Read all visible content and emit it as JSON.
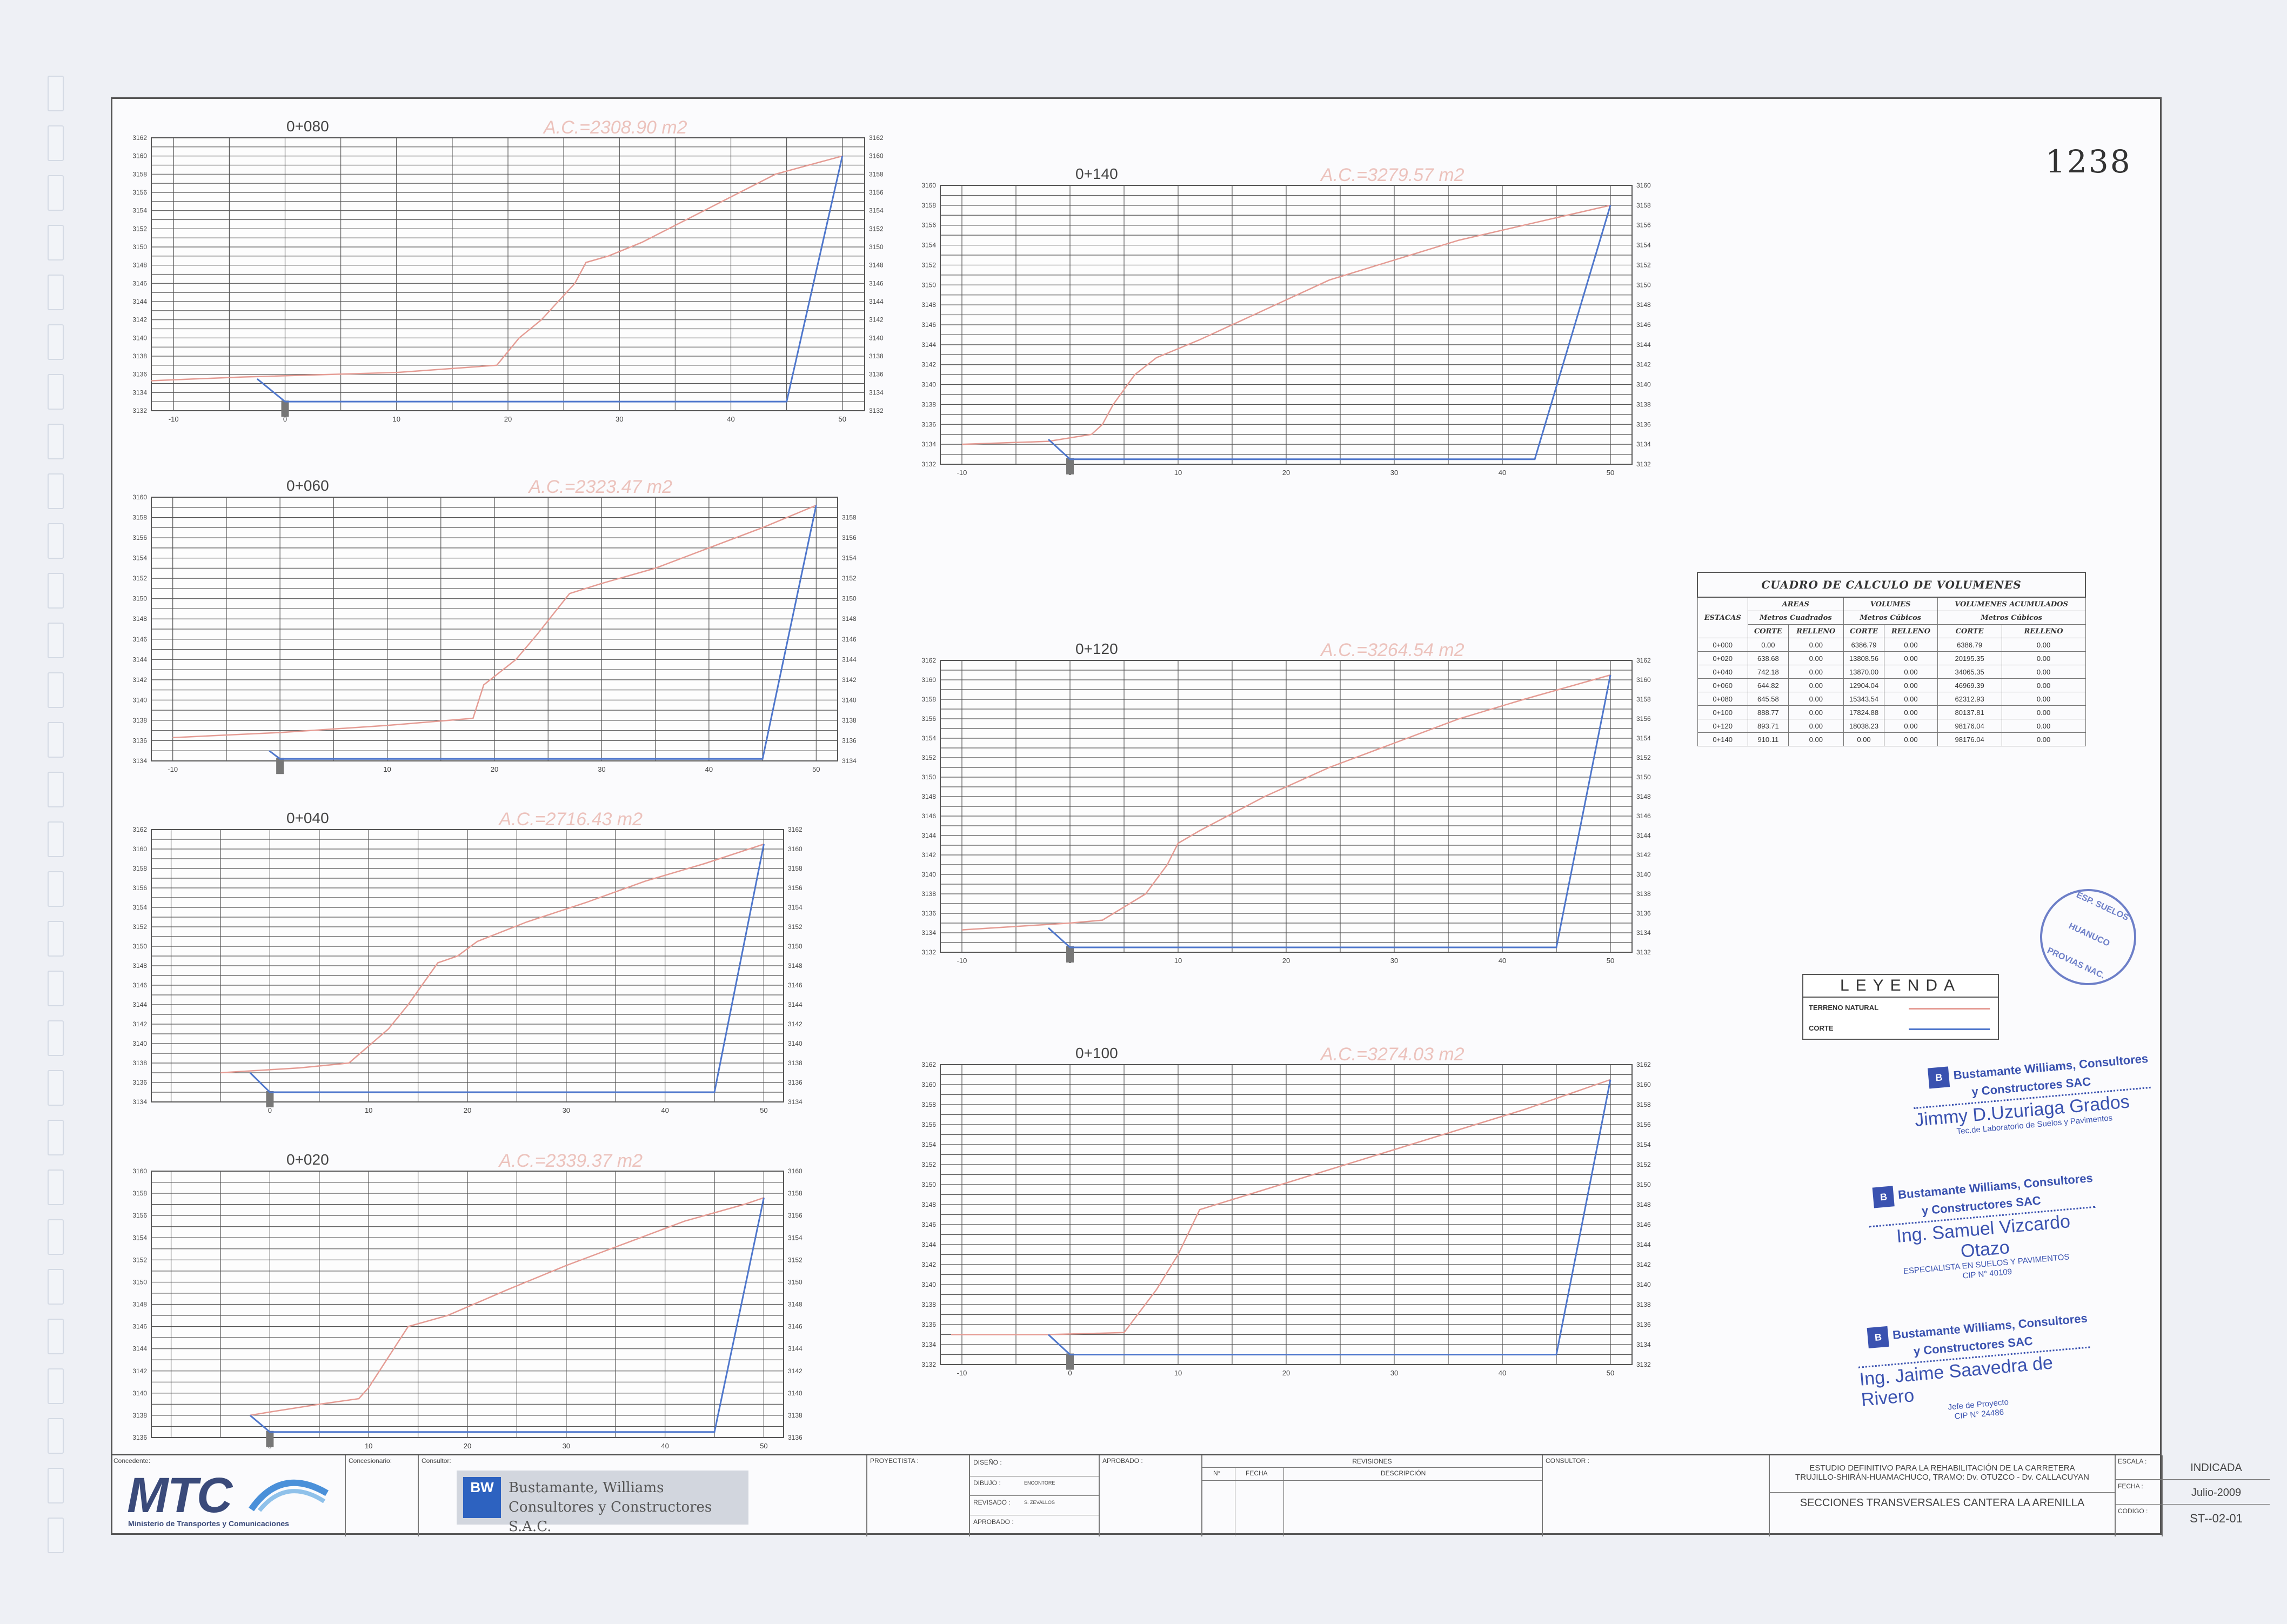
{
  "sheet": {
    "page_number": "1238",
    "sections": [
      {
        "station": "0+080",
        "area": "A.C.=2308.90  m2",
        "x_ticks": [
          "-10",
          "0",
          "10",
          "20",
          "30",
          "40",
          "50"
        ],
        "y_ticks": [
          "3132",
          "3134",
          "3136",
          "3138",
          "3140",
          "3142",
          "3144",
          "3146",
          "3148",
          "3150",
          "3152",
          "3154",
          "3156",
          "3158",
          "3160",
          "3162"
        ],
        "right_ticks": [
          "3132",
          "3134",
          "3136",
          "3138",
          "3140",
          "3142",
          "3144",
          "3146",
          "3148",
          "3150",
          "3152",
          "3154",
          "3156",
          "3158",
          "3160",
          "3162"
        ],
        "ymin": 3132,
        "ymax": 3162,
        "terrain": [
          [
            -12,
            3135.3
          ],
          [
            -4,
            3135.7
          ],
          [
            10,
            3136.2
          ],
          [
            19,
            3137
          ],
          [
            21,
            3140
          ],
          [
            23,
            3142
          ],
          [
            26,
            3146
          ],
          [
            27,
            3148.3
          ],
          [
            29,
            3149
          ],
          [
            32,
            3150.5
          ],
          [
            36,
            3153
          ],
          [
            40,
            3155.5
          ],
          [
            44,
            3158
          ],
          [
            50,
            3160
          ]
        ],
        "cut": [
          [
            -2.5,
            3135.5
          ],
          [
            0,
            3133
          ],
          [
            45,
            3133
          ],
          [
            50,
            3160
          ]
        ]
      },
      {
        "station": "0+060",
        "area": "A.C.=2323.47  m2",
        "x_ticks": [
          "-10",
          "0",
          "10",
          "20",
          "30",
          "40",
          "50"
        ],
        "y_ticks": [
          "3134",
          "3136",
          "3138",
          "3140",
          "3142",
          "3144",
          "3146",
          "3148",
          "3150",
          "3152",
          "3154",
          "3156",
          "3158",
          "3160"
        ],
        "right_ticks": [
          "3134",
          "3136",
          "3138",
          "3140",
          "3142",
          "3144",
          "3146",
          "3148",
          "3150",
          "3152",
          "3154",
          "3156",
          "3158"
        ],
        "ymin": 3134,
        "ymax": 3160,
        "terrain": [
          [
            -10,
            3136.3
          ],
          [
            0,
            3136.8
          ],
          [
            10,
            3137.5
          ],
          [
            18,
            3138.2
          ],
          [
            19,
            3141.5
          ],
          [
            22,
            3144
          ],
          [
            24,
            3146.5
          ],
          [
            27,
            3150.5
          ],
          [
            30,
            3151.5
          ],
          [
            35,
            3153
          ],
          [
            40,
            3155
          ],
          [
            45,
            3157
          ],
          [
            50,
            3159.2
          ]
        ],
        "cut": [
          [
            -1,
            3135
          ],
          [
            0,
            3134.2
          ],
          [
            45,
            3134.2
          ],
          [
            50,
            3159.2
          ]
        ]
      },
      {
        "station": "0+040",
        "area": "A.C.=2716.43  m2",
        "x_ticks": [
          "0",
          "10",
          "20",
          "30",
          "40",
          "50"
        ],
        "y_ticks": [
          "3134",
          "3136",
          "3138",
          "3140",
          "3142",
          "3144",
          "3146",
          "3148",
          "3150",
          "3152",
          "3154",
          "3156",
          "3158",
          "3160",
          "3162"
        ],
        "right_ticks": [
          "3134",
          "3136",
          "3138",
          "3140",
          "3142",
          "3144",
          "3146",
          "3148",
          "3150",
          "3152",
          "3154",
          "3156",
          "3158",
          "3160",
          "3162"
        ],
        "ymin": 3134,
        "ymax": 3162,
        "terrain": [
          [
            -5,
            3137
          ],
          [
            3,
            3137.5
          ],
          [
            8,
            3138
          ],
          [
            12,
            3141.5
          ],
          [
            14,
            3144
          ],
          [
            17,
            3148.3
          ],
          [
            19,
            3149
          ],
          [
            21,
            3150.5
          ],
          [
            26,
            3152.5
          ],
          [
            32,
            3154.5
          ],
          [
            38,
            3156.7
          ],
          [
            44,
            3158.5
          ],
          [
            50,
            3160.5
          ]
        ],
        "cut": [
          [
            -2,
            3137
          ],
          [
            0,
            3135
          ],
          [
            45,
            3135
          ],
          [
            50,
            3160.5
          ]
        ]
      },
      {
        "station": "0+020",
        "area": "A.C.=2339.37  m2",
        "x_ticks": [
          "0",
          "10",
          "20",
          "30",
          "40",
          "50"
        ],
        "y_ticks": [
          "3136",
          "3138",
          "3140",
          "3142",
          "3144",
          "3146",
          "3148",
          "3150",
          "3152",
          "3154",
          "3156",
          "3158",
          "3160"
        ],
        "right_ticks": [
          "3136",
          "3138",
          "3140",
          "3142",
          "3144",
          "3146",
          "3148",
          "3150",
          "3152",
          "3154",
          "3156",
          "3158",
          "3160"
        ],
        "ymin": 3136,
        "ymax": 3160,
        "terrain": [
          [
            -2,
            3138
          ],
          [
            0,
            3138.3
          ],
          [
            5,
            3139
          ],
          [
            9,
            3139.5
          ],
          [
            10,
            3140.5
          ],
          [
            14,
            3146
          ],
          [
            18,
            3147
          ],
          [
            24,
            3149.3
          ],
          [
            30,
            3151.5
          ],
          [
            36,
            3153.5
          ],
          [
            42,
            3155.5
          ],
          [
            48,
            3157
          ],
          [
            50,
            3157.6
          ]
        ],
        "cut": [
          [
            -2,
            3138
          ],
          [
            0,
            3136.5
          ],
          [
            45,
            3136.5
          ],
          [
            50,
            3157.6
          ]
        ]
      },
      {
        "station": "0+140",
        "area": "A.C.=3279.57  m2",
        "x_ticks": [
          "-10",
          "0",
          "10",
          "20",
          "30",
          "40",
          "50"
        ],
        "y_ticks": [
          "3132",
          "3134",
          "3136",
          "3138",
          "3140",
          "3142",
          "3144",
          "3146",
          "3148",
          "3150",
          "3152",
          "3154",
          "3156",
          "3158",
          "3160"
        ],
        "right_ticks": [
          "3132",
          "3134",
          "3136",
          "3138",
          "3140",
          "3142",
          "3144",
          "3146",
          "3148",
          "3150",
          "3152",
          "3154",
          "3156",
          "3158",
          "3160"
        ],
        "ymin": 3132,
        "ymax": 3160,
        "terrain": [
          [
            -10,
            3134
          ],
          [
            -2,
            3134.3
          ],
          [
            2,
            3135
          ],
          [
            3,
            3136
          ],
          [
            4,
            3138
          ],
          [
            6,
            3141
          ],
          [
            8,
            3142.7
          ],
          [
            12,
            3144.5
          ],
          [
            18,
            3147.5
          ],
          [
            24,
            3150.5
          ],
          [
            30,
            3152.5
          ],
          [
            36,
            3154.5
          ],
          [
            42,
            3156
          ],
          [
            50,
            3158
          ]
        ],
        "cut": [
          [
            -2,
            3134.5
          ],
          [
            0,
            3132.5
          ],
          [
            43,
            3132.5
          ],
          [
            50,
            3158
          ]
        ]
      },
      {
        "station": "0+120",
        "area": "A.C.=3264.54  m2",
        "x_ticks": [
          "-10",
          "0",
          "10",
          "20",
          "30",
          "40",
          "50"
        ],
        "y_ticks": [
          "3132",
          "3134",
          "3136",
          "3138",
          "3140",
          "3142",
          "3144",
          "3146",
          "3148",
          "3150",
          "3152",
          "3154",
          "3156",
          "3158",
          "3160",
          "3162"
        ],
        "right_ticks": [
          "3132",
          "3134",
          "3136",
          "3138",
          "3140",
          "3142",
          "3144",
          "3146",
          "3148",
          "3150",
          "3152",
          "3154",
          "3156",
          "3158",
          "3160",
          "3162"
        ],
        "ymin": 3132,
        "ymax": 3162,
        "terrain": [
          [
            -10,
            3134.3
          ],
          [
            0,
            3135
          ],
          [
            3,
            3135.3
          ],
          [
            7,
            3138
          ],
          [
            9,
            3141
          ],
          [
            10,
            3143.2
          ],
          [
            12,
            3144.5
          ],
          [
            18,
            3148
          ],
          [
            24,
            3151
          ],
          [
            30,
            3153.5
          ],
          [
            36,
            3156
          ],
          [
            42,
            3158
          ],
          [
            50,
            3160.5
          ]
        ],
        "cut": [
          [
            -2,
            3134.5
          ],
          [
            0,
            3132.5
          ],
          [
            45,
            3132.5
          ],
          [
            50,
            3160.5
          ]
        ]
      },
      {
        "station": "0+100",
        "area": "A.C.=3274.03  m2",
        "x_ticks": [
          "-10",
          "0",
          "10",
          "20",
          "30",
          "40",
          "50"
        ],
        "y_ticks": [
          "3132",
          "3134",
          "3136",
          "3138",
          "3140",
          "3142",
          "3144",
          "3146",
          "3148",
          "3150",
          "3152",
          "3154",
          "3156",
          "3158",
          "3160",
          "3162"
        ],
        "right_ticks": [
          "3132",
          "3134",
          "3136",
          "3138",
          "3140",
          "3142",
          "3144",
          "3146",
          "3148",
          "3150",
          "3152",
          "3154",
          "3156",
          "3158",
          "3160",
          "3162"
        ],
        "ymin": 3132,
        "ymax": 3162,
        "terrain": [
          [
            -11,
            3135
          ],
          [
            -2,
            3135
          ],
          [
            5,
            3135.2
          ],
          [
            8,
            3139.5
          ],
          [
            10,
            3143
          ],
          [
            12,
            3147.5
          ],
          [
            18,
            3149.5
          ],
          [
            24,
            3151.5
          ],
          [
            30,
            3153.5
          ],
          [
            36,
            3155.5
          ],
          [
            42,
            3157.5
          ],
          [
            50,
            3160.5
          ]
        ],
        "cut": [
          [
            -2,
            3135
          ],
          [
            0,
            3133
          ],
          [
            45,
            3133
          ],
          [
            50,
            3160.5
          ]
        ]
      }
    ],
    "colors": {
      "terrain": "#e59c94",
      "cut": "#4f77cc",
      "grid": "#555555"
    }
  },
  "volumes": {
    "title": "CUADRO DE CALCULO DE VOLUMENES",
    "h_estacas": "ESTACAS",
    "h_areas": "AREAS",
    "h_areas_sub": "Metros Cuadrados",
    "h_vol": "VOLUMES",
    "h_vol_sub": "Metros Cúbicos",
    "h_acum": "VOLUMENES ACUMULADOS",
    "h_acum_sub": "Metros Cúbicos",
    "h_corte": "CORTE",
    "h_relleno": "RELLENO",
    "rows": [
      {
        "est": "0+000",
        "a_c": "0.00",
        "a_r": "0.00",
        "v_c": "6386.79",
        "v_r": "0.00",
        "ac_c": "6386.79",
        "ac_r": "0.00"
      },
      {
        "est": "0+020",
        "a_c": "638.68",
        "a_r": "0.00",
        "v_c": "13808.56",
        "v_r": "0.00",
        "ac_c": "20195.35",
        "ac_r": "0.00"
      },
      {
        "est": "0+040",
        "a_c": "742.18",
        "a_r": "0.00",
        "v_c": "13870.00",
        "v_r": "0.00",
        "ac_c": "34065.35",
        "ac_r": "0.00"
      },
      {
        "est": "0+060",
        "a_c": "644.82",
        "a_r": "0.00",
        "v_c": "12904.04",
        "v_r": "0.00",
        "ac_c": "46969.39",
        "ac_r": "0.00"
      },
      {
        "est": "0+080",
        "a_c": "645.58",
        "a_r": "0.00",
        "v_c": "15343.54",
        "v_r": "0.00",
        "ac_c": "62312.93",
        "ac_r": "0.00"
      },
      {
        "est": "0+100",
        "a_c": "888.77",
        "a_r": "0.00",
        "v_c": "17824.88",
        "v_r": "0.00",
        "ac_c": "80137.81",
        "ac_r": "0.00"
      },
      {
        "est": "0+120",
        "a_c": "893.71",
        "a_r": "0.00",
        "v_c": "18038.23",
        "v_r": "0.00",
        "ac_c": "98176.04",
        "ac_r": "0.00"
      },
      {
        "est": "0+140",
        "a_c": "910.11",
        "a_r": "0.00",
        "v_c": "0.00",
        "v_r": "0.00",
        "ac_c": "98176.04",
        "ac_r": "0.00"
      }
    ]
  },
  "legend": {
    "title": "LEYENDA",
    "terrain": "TERRENO NATURAL",
    "cut": "CORTE"
  },
  "stamps": {
    "company_1": "Bustamante Williams, Consultores",
    "company_2": "y Constructores SAC",
    "s1_name": "Jimmy D.Uzuriaga Grados",
    "s1_role": "Tec.de Laboratorio de Suelos y Pavimentos",
    "s2_name": "Ing. Samuel Vizcardo Otazo",
    "s2_role": "ESPECIALISTA EN SUELOS Y PAVIMENTOS",
    "s2_cip": "CIP N° 40109",
    "s3_name": "Ing. Jaime Saavedra de Rivero",
    "s3_role": "Jefe de Proyecto",
    "s3_cip": "CIP N° 24486",
    "seal_top": "ESP. SUELOS",
    "seal_mid": "HUANUCO",
    "seal_bot": "PROVIAS NAC."
  },
  "titleblock": {
    "concedente_label": "Concedente:",
    "mtc_logo": "MTC",
    "mtc_sub": "Ministerio de Transportes y Comunicaciones",
    "concesionario_label": "Concesionario:",
    "consultor_label": "Consultor:",
    "bw_line1": "Bustamante, Williams",
    "bw_line2": "Consultores y Constructores S.A.C.",
    "bw_mark": "BW",
    "proyectista_label": "PROYECTISTA :",
    "diseno_label": "DISEÑO :",
    "dibujo_label": "DIBUJO :",
    "dibujo_value": "ENCONTORE",
    "revisado_label": "REVISADO :",
    "revisado_value": "S. ZEVALLOS",
    "aprobado_label": "APROBADO :",
    "aprobado2_label": "APROBADO :",
    "revisiones_label": "REVISIONES",
    "rev_no": "N°",
    "rev_fecha": "FECHA",
    "rev_desc": "DESCRIPCIÓN",
    "consultor2_label": "CONSULTOR :",
    "study_line1": "ESTUDIO DEFINITIVO PARA LA REHABILITACIÓN DE LA CARRETERA",
    "study_line2": "TRUJILLO-SHIRÁN-HUAMACHUCO, TRAMO: Dv. OTUZCO - Dv. CALLACUYAN",
    "drawing_title": "SECCIONES TRANSVERSALES CANTERA LA ARENILLA",
    "escala_label": "ESCALA :",
    "escala_value": "INDICADA",
    "fecha_label": "FECHA :",
    "fecha_value": "Julio-2009",
    "codigo_label": "CODIGO :",
    "codigo_value": "ST--02-01"
  }
}
